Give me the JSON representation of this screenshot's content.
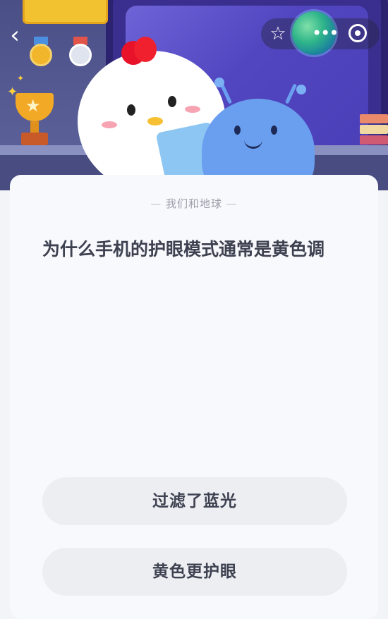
{
  "header": {
    "back_icon": "chevron-left-icon",
    "actions": [
      "star-icon",
      "globe-icon",
      "more-icon",
      "target-icon"
    ]
  },
  "quiz": {
    "category": "我们和地球",
    "question": "为什么手机的护眼模式通常是黄色调",
    "options": [
      {
        "label": "过滤了蓝光"
      },
      {
        "label": "黄色更护眼"
      }
    ]
  },
  "colors": {
    "hero_background": "#565b94",
    "card_background": "#f8f9fc",
    "option_background": "#eceef2",
    "text_primary": "#3d4150",
    "text_muted": "#9a9ca8"
  }
}
